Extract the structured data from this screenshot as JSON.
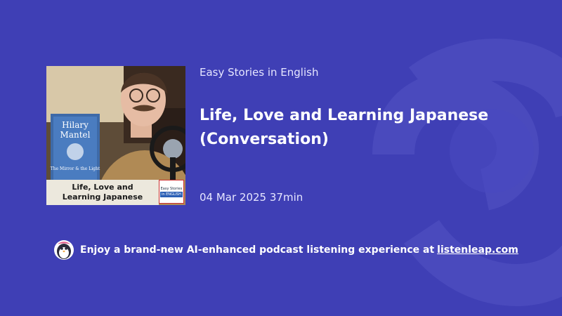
{
  "episode": {
    "show_name": "Easy Stories in English",
    "title": "Life, Love and Learning Japanese (Conversation)",
    "date": "04 Mar 2025",
    "duration": "37min",
    "cover": {
      "caption_line1": "Life, Love and",
      "caption_line2": "Learning Japanese",
      "book_author_first": "Hilary",
      "book_author_last": "Mantel",
      "book_title": "The Mirror & the Light",
      "badge_line1": "Easy Stories",
      "badge_line2": "in ENGLISH"
    }
  },
  "promo": {
    "text": "Enjoy a brand-new AI-enhanced podcast listening experience at",
    "link": "listenleap.com",
    "icon": "penguin-logo-icon"
  },
  "colors": {
    "background": "#3f3fb5",
    "text": "#ffffff"
  }
}
